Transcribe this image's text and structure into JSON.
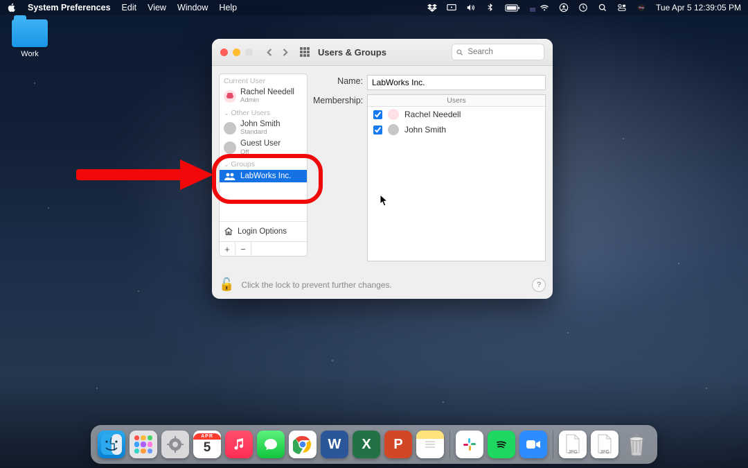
{
  "menubar": {
    "app_name": "System Preferences",
    "items": [
      "Edit",
      "View",
      "Window",
      "Help"
    ],
    "datetime": "Tue Apr 5  12:39:05 PM"
  },
  "desktop": {
    "folder1_label": "Work"
  },
  "window": {
    "title": "Users & Groups",
    "search_placeholder": "Search"
  },
  "sidebar": {
    "sections": {
      "current_user": "Current User",
      "other_users": "Other Users",
      "groups": "Groups"
    },
    "current_user": {
      "name": "Rachel Needell",
      "role": "Admin"
    },
    "other_users": [
      {
        "name": "John Smith",
        "role": "Standard"
      },
      {
        "name": "Guest User",
        "role": "Off"
      }
    ],
    "groups": [
      {
        "name": "LabWorks Inc.",
        "selected": true
      }
    ],
    "login_options": "Login Options"
  },
  "detail": {
    "name_label": "Name:",
    "name_value": "LabWorks Inc.",
    "membership_label": "Membership:",
    "membership_header": "Users",
    "members": [
      {
        "name": "Rachel Needell",
        "checked": true,
        "avatar": "pink"
      },
      {
        "name": "John Smith",
        "checked": true,
        "avatar": "gray"
      }
    ]
  },
  "footer": {
    "lock_text": "Click the lock to prevent further changes.",
    "help": "?"
  },
  "dock": {
    "calendar_month": "APR",
    "calendar_day": "5"
  }
}
